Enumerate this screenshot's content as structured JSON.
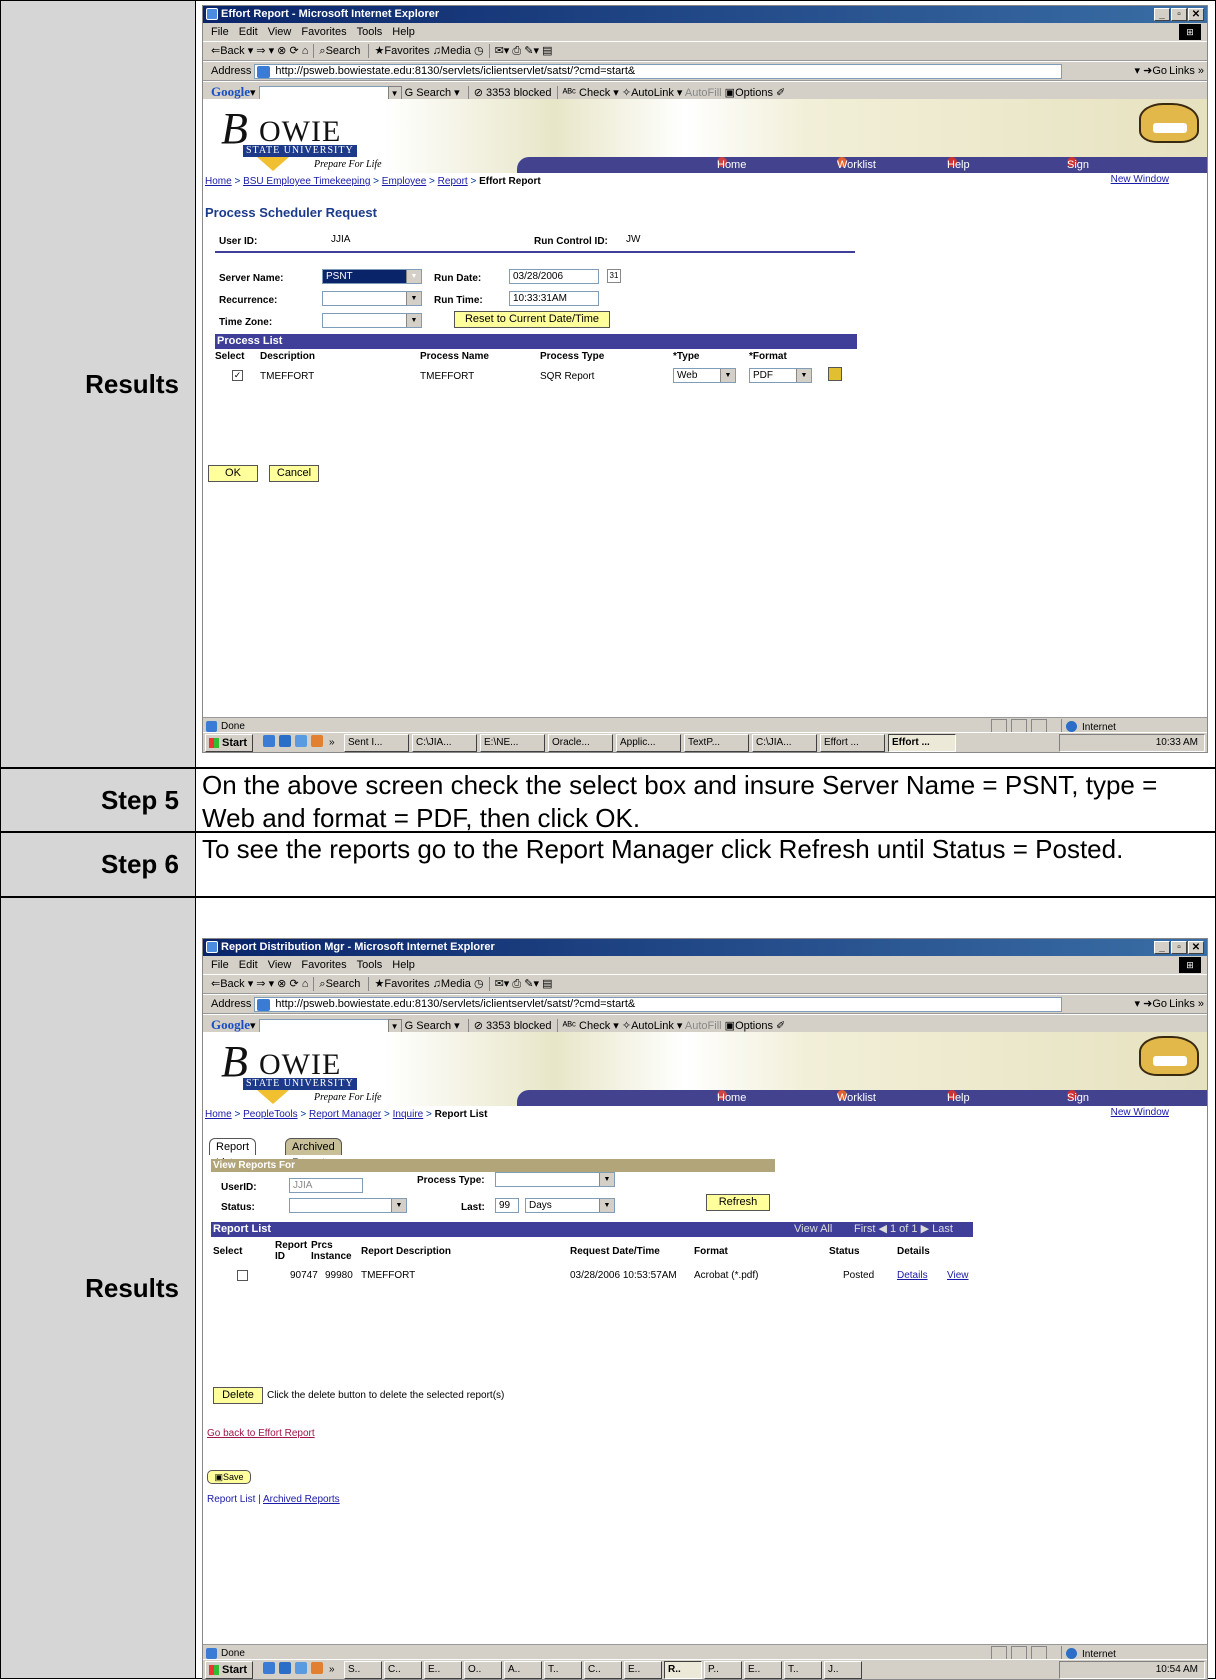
{
  "steps": {
    "results_label": "Results",
    "step5_label": "Step 5",
    "step5_text": "On the above screen check the select box and insure Server Name = PSNT, type = Web and format = PDF, then click OK.",
    "step6_label": "Step 6",
    "step6_text": "To see the reports go to the Report Manager click Refresh until Status = Posted."
  },
  "common": {
    "menu": [
      "File",
      "Edit",
      "View",
      "Favorites",
      "Tools",
      "Help"
    ],
    "toolbar_back": "⇐Back ▾ ⇒ ▾",
    "toolbar_search": "Search",
    "toolbar_favorites": "Favorites",
    "toolbar_media": "Media",
    "address_label": "Address",
    "address_url": "http://psweb.bowiestate.edu:8130/servlets/iclientservlet/satst/?cmd=start&",
    "go": "Go",
    "links": "Links »",
    "google": "Google",
    "g_search": "Search",
    "blocked": "3353 blocked",
    "check": "Check",
    "autolink": "AutoLink",
    "autofill": "AutoFill",
    "options": "Options",
    "logo_b": "B",
    "logo_owie": "OWIE",
    "logo_univ": "STATE UNIVERSITY",
    "logo_tag": "Prepare For Life",
    "nav_home": "Home",
    "nav_worklist": "Worklist",
    "nav_help": "Help",
    "nav_signout": "Sign Out",
    "new_window": "New Window",
    "status_done": "Done",
    "status_zone": "Internet",
    "start": "Start",
    "colors": {
      "titlebar": "#0a246a",
      "navbar": "#43428f",
      "button": "#ffff9c",
      "link": "#1a1aa8"
    }
  },
  "win1": {
    "title": "Effort Report - Microsoft Internet Explorer",
    "crumb_links": [
      "Home",
      "BSU Employee Timekeeping",
      "Employee",
      "Report"
    ],
    "crumb_current": "Effort Report",
    "page_title": "Process Scheduler Request",
    "user_id_label": "User ID:",
    "user_id": "JJIA",
    "run_control_label": "Run Control ID:",
    "run_control": "JW",
    "server_label": "Server Name:",
    "server_value": "PSNT",
    "run_date_label": "Run Date:",
    "run_date": "03/28/2006",
    "recurrence_label": "Recurrence:",
    "run_time_label": "Run Time:",
    "run_time": "10:33:31AM",
    "reset_btn": "Reset to Current Date/Time",
    "timezone_label": "Time Zone:",
    "process_list_header": "Process List",
    "col_select": "Select",
    "col_description": "Description",
    "col_process_name": "Process Name",
    "col_process_type": "Process Type",
    "col_type": "*Type",
    "col_format": "*Format",
    "row_desc": "TMEFFORT",
    "row_name": "TMEFFORT",
    "row_ptype": "SQR Report",
    "row_type": "Web",
    "row_format": "PDF",
    "ok_btn": "OK",
    "cancel_btn": "Cancel",
    "tasks": [
      "Sent I...",
      "C:\\JIA...",
      "E:\\NE...",
      "Oracle...",
      "Applic...",
      "TextP...",
      "C:\\JIA...",
      "Effort ...",
      "Effort ..."
    ],
    "clock": "10:33 AM"
  },
  "win2": {
    "title": "Report Distribution Mgr - Microsoft Internet Explorer",
    "crumb_links": [
      "Home",
      "PeopleTools",
      "Report Manager",
      "Inquire"
    ],
    "crumb_current": "Report List",
    "tab_report_list": "Report List",
    "tab_archived": "Archived Reports",
    "view_for": "View Reports For",
    "userid_label": "UserID:",
    "userid_value": "JJIA",
    "ptype_label": "Process Type:",
    "status_label": "Status:",
    "last_label": "Last:",
    "last_value": "99",
    "last_unit": "Days",
    "refresh_btn": "Refresh",
    "list_header": "Report List",
    "view_all": "View All",
    "first": "First",
    "page_info": "1 of 1",
    "last_nav": "Last",
    "col_select": "Select",
    "col_report_id": "Report ID",
    "col_prcs": "Prcs Instance",
    "col_desc": "Report Description",
    "col_date": "Request Date/Time",
    "col_format": "Format",
    "col_status": "Status",
    "col_details": "Details",
    "row_id": "90747",
    "row_prcs": "99980",
    "row_desc": "TMEFFORT",
    "row_date": "03/28/2006 10:53:57AM",
    "row_format": "Acrobat (*.pdf)",
    "row_status": "Posted",
    "row_details": "Details",
    "row_view": "View",
    "delete_btn": "Delete",
    "delete_hint": "Click the delete button to delete the selected report(s)",
    "go_back": "Go back to Effort Report",
    "save_btn": "Save",
    "footer_report_list": "Report List",
    "footer_sep": "|",
    "footer_archived": "Archived Reports",
    "tasks": [
      "S..",
      "C..",
      "E..",
      "O..",
      "A..",
      "T..",
      "C..",
      "E..",
      "R..",
      "P..",
      "E..",
      "T..",
      "J.."
    ],
    "clock": "10:54 AM"
  }
}
